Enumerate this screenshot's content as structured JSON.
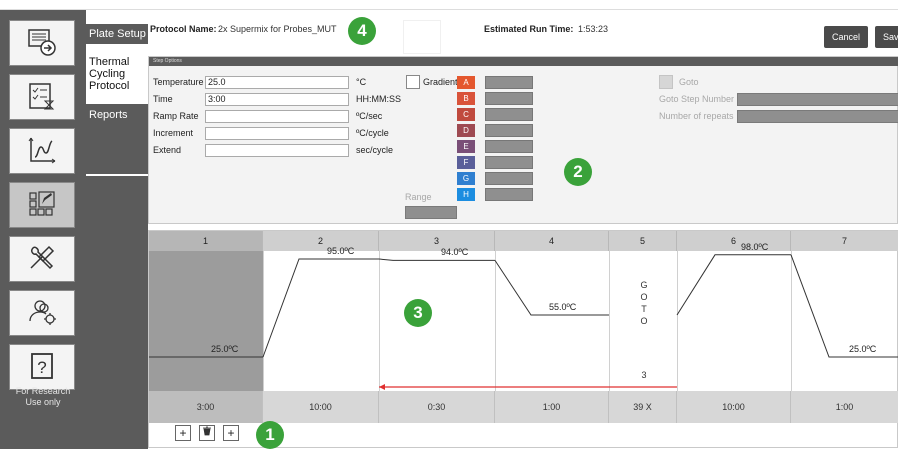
{
  "nav": {
    "rail_buttons": [
      {
        "icon": "run-protocol-icon"
      },
      {
        "icon": "checklist-timer-icon"
      },
      {
        "icon": "data-analysis-icon"
      },
      {
        "icon": "plate-layout-icon"
      },
      {
        "icon": "tools-icon"
      },
      {
        "icon": "user-settings-icon"
      },
      {
        "icon": "help-icon"
      }
    ],
    "footer_line1": "For Research",
    "footer_line2": "Use only"
  },
  "subnav": {
    "plate_setup": "Plate Setup",
    "thermal_l1": "Thermal",
    "thermal_l2": "Cycling",
    "thermal_l3": "Protocol",
    "reports": "Reports"
  },
  "header": {
    "protocol_label": "Protocol Name:",
    "protocol_value": "2x Supermix for Probes_MUT",
    "runtime_label": "Estimated Run Time:",
    "runtime_value": "1:53:23",
    "cancel": "Cancel",
    "save": "Save"
  },
  "step_options": {
    "title": "Step Options",
    "temperature_label": "Temperature",
    "temperature_value": "25.0",
    "temperature_unit": "°C",
    "time_label": "Time",
    "time_value": "3:00",
    "time_unit": "HH:MM:SS",
    "ramp_label": "Ramp Rate",
    "ramp_value": "",
    "ramp_unit": "ºC/sec",
    "increment_label": "Increment",
    "increment_value": "",
    "increment_unit": "ºC/cycle",
    "extend_label": "Extend",
    "extend_value": "",
    "extend_unit": "sec/cycle",
    "gradient_label": "Gradient",
    "range_label": "Range",
    "zones": [
      {
        "letter": "A",
        "color": "#e4572e"
      },
      {
        "letter": "B",
        "color": "#d9533a"
      },
      {
        "letter": "C",
        "color": "#c04a3e"
      },
      {
        "letter": "D",
        "color": "#9e4a52"
      },
      {
        "letter": "E",
        "color": "#7a4f78"
      },
      {
        "letter": "F",
        "color": "#5a5f9a"
      },
      {
        "letter": "G",
        "color": "#2f7fd0"
      },
      {
        "letter": "H",
        "color": "#1c8de0"
      }
    ],
    "goto_label": "Goto",
    "goto_step_label": "Goto Step Number",
    "repeats_label": "Number of repeats"
  },
  "graph": {
    "steps": [
      {
        "num": "1",
        "temp": "25.0ºC",
        "time": "3:00"
      },
      {
        "num": "2",
        "temp": "95.0ºC",
        "time": "10:00"
      },
      {
        "num": "3",
        "temp": "94.0ºC",
        "time": "0:30"
      },
      {
        "num": "4",
        "temp": "55.0ºC",
        "time": "1:00"
      },
      {
        "num": "5",
        "temp": "",
        "time": "39 X"
      },
      {
        "num": "6",
        "temp": "98.0ºC",
        "time": "10:00"
      },
      {
        "num": "7",
        "temp": "25.0ºC",
        "time": "1:00"
      }
    ],
    "goto_letters": [
      "G",
      "O",
      "T",
      "O"
    ],
    "goto_target": "3",
    "arrow_color": "#e03030"
  },
  "toolbar": {
    "add_before": "+",
    "delete": "🗑",
    "add_after": "+"
  },
  "callouts": [
    "1",
    "2",
    "3",
    "4"
  ]
}
